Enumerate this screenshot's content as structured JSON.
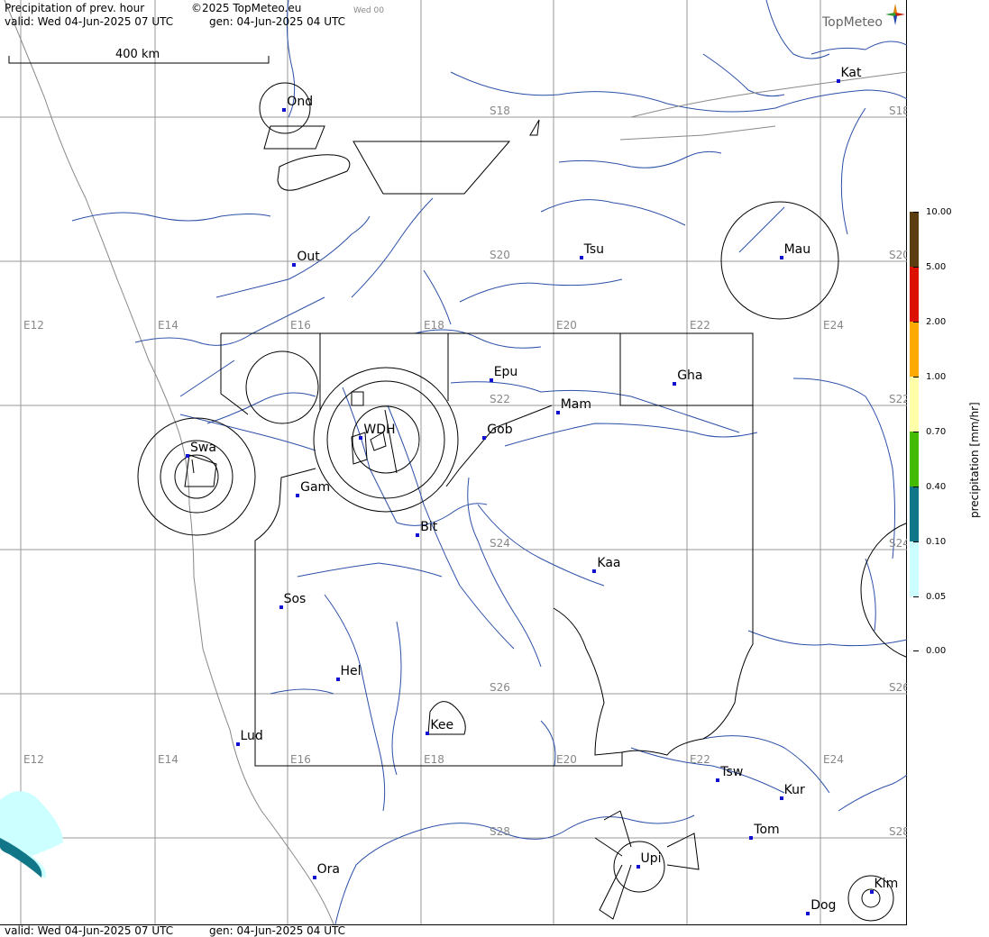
{
  "header": {
    "title": "Precipitation of prev. hour",
    "copyright": "©2025 TopMeteo.eu",
    "day_tag": "Wed 00",
    "valid": "valid:  Wed  04-Jun-2025  07 UTC",
    "gen": "gen: 04-Jun-2025 04 UTC",
    "brand": "TopMeteo"
  },
  "footer": {
    "valid": "valid:  Wed  04-Jun-2025  07 UTC",
    "gen": "gen: 04-Jun-2025 04 UTC"
  },
  "scale_bar": {
    "label": "400 km"
  },
  "grid_labels": {
    "lat": [
      "S18",
      "S20",
      "S22",
      "S24",
      "S26",
      "S28"
    ],
    "lon": [
      "E12",
      "E14",
      "E16",
      "E18",
      "E20",
      "E22",
      "E24"
    ]
  },
  "cities": [
    {
      "name": "Ond",
      "lon": 15.95,
      "lat": -17.9
    },
    {
      "name": "Kat",
      "lon": 24.25,
      "lat": -17.5
    },
    {
      "name": "Tsu",
      "lon": 20.4,
      "lat": -19.95
    },
    {
      "name": "Out",
      "lon": 16.1,
      "lat": -20.05
    },
    {
      "name": "Mau",
      "lon": 23.4,
      "lat": -19.95
    },
    {
      "name": "Epu",
      "lon": 19.05,
      "lat": -21.65
    },
    {
      "name": "Gha",
      "lon": 21.8,
      "lat": -21.7
    },
    {
      "name": "Mam",
      "lon": 20.05,
      "lat": -22.1
    },
    {
      "name": "WDH",
      "lon": 17.1,
      "lat": -22.45
    },
    {
      "name": "Gob",
      "lon": 18.95,
      "lat": -22.45
    },
    {
      "name": "Swa",
      "lon": 14.5,
      "lat": -22.7
    },
    {
      "name": "Gam",
      "lon": 16.15,
      "lat": -23.25
    },
    {
      "name": "Bit",
      "lon": 17.95,
      "lat": -23.8
    },
    {
      "name": "Kaa",
      "lon": 20.6,
      "lat": -24.3
    },
    {
      "name": "Sos",
      "lon": 15.9,
      "lat": -24.8
    },
    {
      "name": "Hel",
      "lon": 16.75,
      "lat": -25.8
    },
    {
      "name": "Kee",
      "lon": 18.1,
      "lat": -26.55
    },
    {
      "name": "Lud",
      "lon": 15.25,
      "lat": -26.7
    },
    {
      "name": "Tsw",
      "lon": 22.45,
      "lat": -27.2
    },
    {
      "name": "Kur",
      "lon": 23.4,
      "lat": -27.45
    },
    {
      "name": "Tom",
      "lon": 22.95,
      "lat": -28.0
    },
    {
      "name": "Upi",
      "lon": 21.25,
      "lat": -28.4
    },
    {
      "name": "Ora",
      "lon": 16.4,
      "lat": -28.55
    },
    {
      "name": "Kim",
      "lon": 24.75,
      "lat": -28.75
    },
    {
      "name": "Dog",
      "lon": 23.8,
      "lat": -29.05
    }
  ],
  "legend": {
    "title": "precipitation [mm/hr]",
    "ticks": [
      "10.00",
      "5.00",
      "2.00",
      "1.00",
      "0.70",
      "0.40",
      "0.10",
      "0.05",
      "0.00"
    ],
    "colors": [
      "#5a3d10",
      "#dd1100",
      "#ffaa00",
      "#ffffaa",
      "#44bb00",
      "#117788",
      "#ccffff",
      "#ffffff"
    ]
  },
  "precip_areas": [
    {
      "level": "0.05",
      "color": "#ccffff"
    },
    {
      "level": "0.10",
      "color": "#117788"
    }
  ]
}
